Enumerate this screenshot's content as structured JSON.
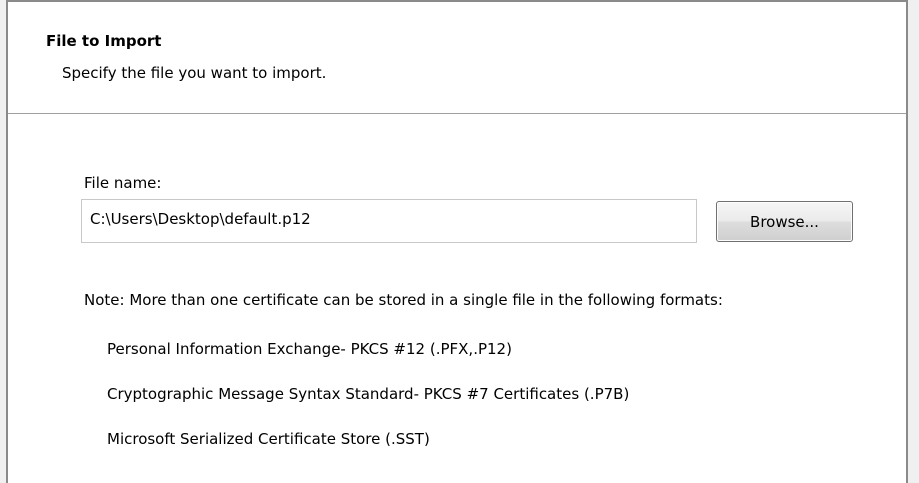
{
  "header": {
    "title": "File to Import",
    "subtitle": "Specify the file you want to import."
  },
  "file": {
    "label": "File name:",
    "value": "C:\\Users\\Desktop\\default.p12",
    "browse_label": "Browse..."
  },
  "note": "Note:  More than one certificate can be stored in a single file in the following formats:",
  "formats": [
    "Personal Information Exchange- PKCS #12 (.PFX,.P12)",
    "Cryptographic Message Syntax Standard- PKCS #7 Certificates (.P7B)",
    "Microsoft Serialized Certificate Store (.SST)"
  ],
  "colors": {
    "background": "#ffffff",
    "divider": "#a0a0a0",
    "border": "#8a8a8a"
  }
}
